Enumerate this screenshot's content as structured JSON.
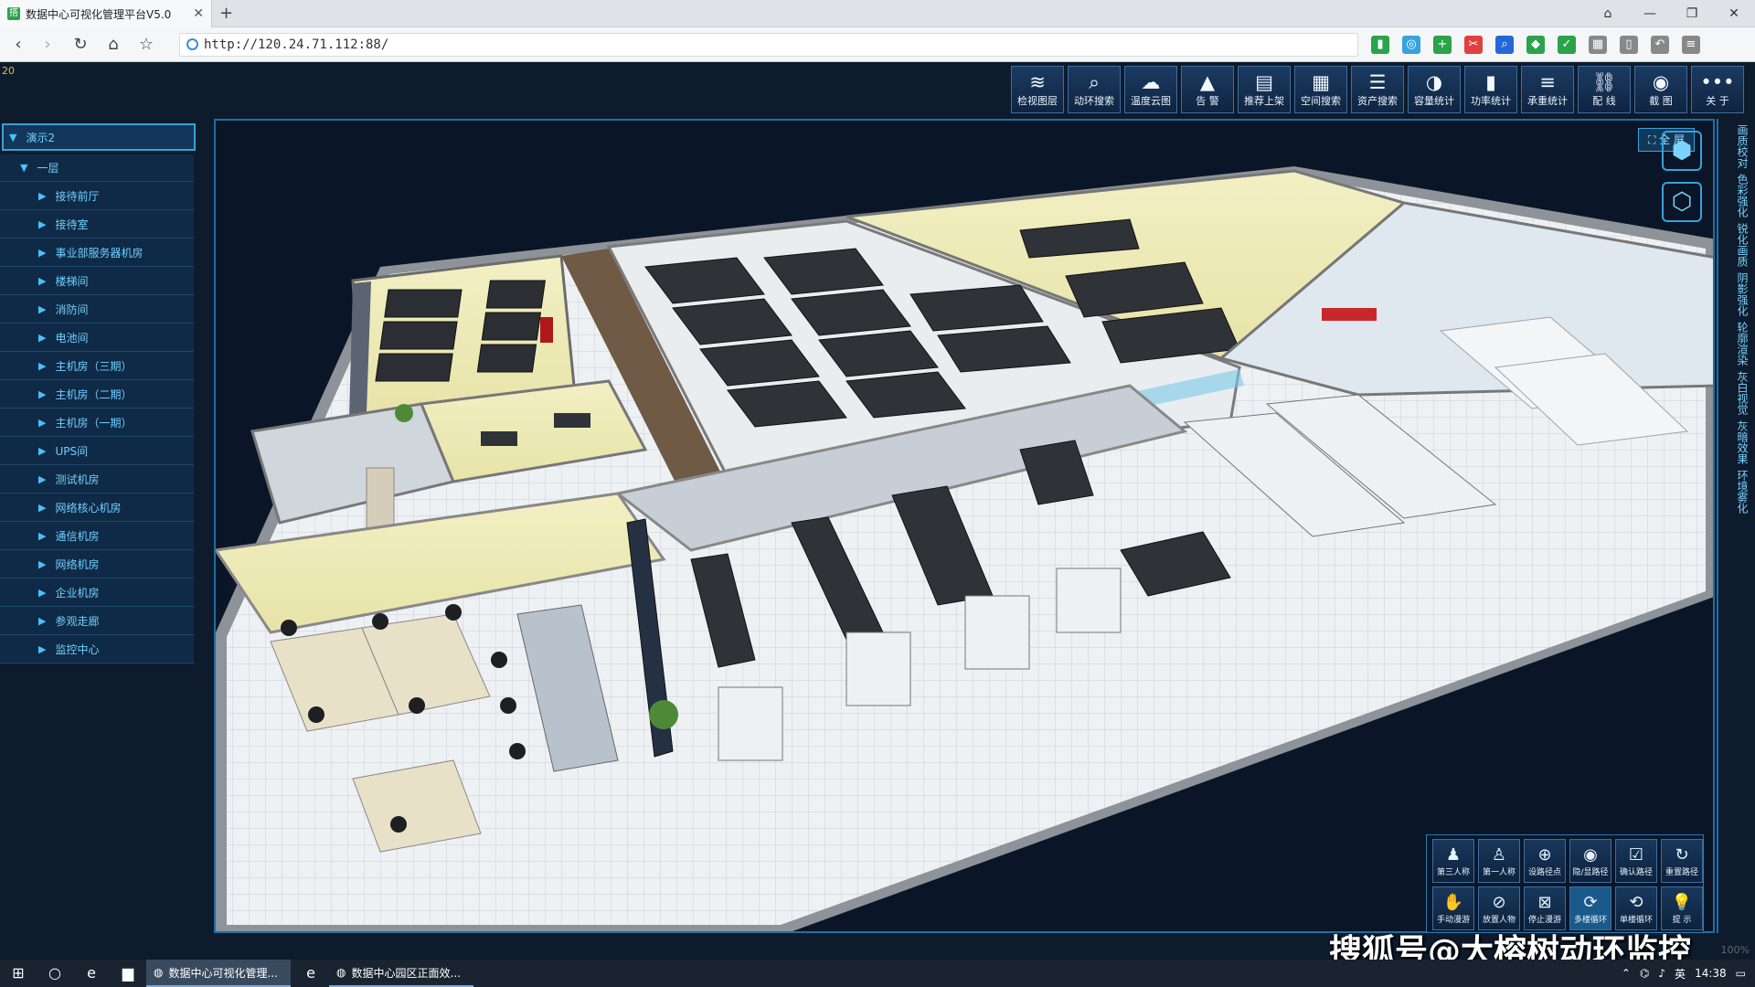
{
  "browser": {
    "tab_title": "数据中心可视化管理平台V5.0",
    "url": "http://120.24.71.112:88/",
    "new_tab_label": "+",
    "zoom": "100%"
  },
  "app": {
    "fps": "20",
    "toolbar": [
      {
        "label": "检视图层",
        "icon": "layers-icon",
        "glyph": "≋"
      },
      {
        "label": "动环搜索",
        "icon": "search-icon",
        "glyph": "⌕"
      },
      {
        "label": "温度云图",
        "icon": "cloud-icon",
        "glyph": "☁"
      },
      {
        "label": "告 警",
        "icon": "warning-icon",
        "glyph": "▲"
      },
      {
        "label": "推荐上架",
        "icon": "document-icon",
        "glyph": "▤"
      },
      {
        "label": "空间搜索",
        "icon": "grid-icon",
        "glyph": "▦"
      },
      {
        "label": "资产搜索",
        "icon": "list-icon",
        "glyph": "☰"
      },
      {
        "label": "容量统计",
        "icon": "pie-icon",
        "glyph": "◑"
      },
      {
        "label": "功率统计",
        "icon": "power-icon",
        "glyph": "▮"
      },
      {
        "label": "承重统计",
        "icon": "weight-icon",
        "glyph": "≡"
      },
      {
        "label": "配 线",
        "icon": "link-icon",
        "glyph": "⛓"
      },
      {
        "label": "截 图",
        "icon": "camera-icon",
        "glyph": "◉"
      },
      {
        "label": "关 于",
        "icon": "more-icon",
        "glyph": "•••"
      }
    ],
    "tree": {
      "root": "演示2",
      "floor": "一层",
      "rooms": [
        "接待前厅",
        "接待室",
        "事业部服务器机房",
        "楼梯间",
        "消防间",
        "电池间",
        "主机房（三期）",
        "主机房（二期）",
        "主机房（一期）",
        "UPS间",
        "测试机房",
        "网络核心机房",
        "通信机房",
        "网络机房",
        "企业机房",
        "参观走廊",
        "监控中心"
      ]
    },
    "fullscreen_label": "全 屏",
    "render_options": [
      "画质校对",
      "色彩强化",
      "锐化画质",
      "阴影强化",
      "轮廓渲染",
      "灰白视觉",
      "灰暗效果",
      "环境雾化"
    ],
    "controls": [
      {
        "label": "第三人称",
        "glyph": "♟",
        "icon": "third-person-icon"
      },
      {
        "label": "第一人称",
        "glyph": "♙",
        "icon": "first-person-icon"
      },
      {
        "label": "设路径点",
        "glyph": "⊕",
        "icon": "waypoint-icon"
      },
      {
        "label": "隐/显路径",
        "glyph": "◉",
        "icon": "eye-icon"
      },
      {
        "label": "确认路径",
        "glyph": "☑",
        "icon": "confirm-icon"
      },
      {
        "label": "重置路径",
        "glyph": "↻",
        "icon": "reset-icon"
      },
      {
        "label": "手动漫游",
        "glyph": "✋",
        "icon": "manual-roam-icon"
      },
      {
        "label": "放置人物",
        "glyph": "⊘",
        "icon": "place-person-icon"
      },
      {
        "label": "停止漫游",
        "glyph": "⊠",
        "icon": "stop-roam-icon"
      },
      {
        "label": "多楼循环",
        "glyph": "⟳",
        "icon": "multi-loop-icon"
      },
      {
        "label": "单楼循环",
        "glyph": "⟲",
        "icon": "single-loop-icon"
      },
      {
        "label": "提 示",
        "glyph": "💡",
        "icon": "tip-icon"
      }
    ]
  },
  "watermark": "搜狐号@大榕树动环监控",
  "taskbar": {
    "windows": [
      "数据中心可视化管理...",
      "数据中心园区正面效..."
    ],
    "time": "14:38",
    "ime": "英"
  }
}
